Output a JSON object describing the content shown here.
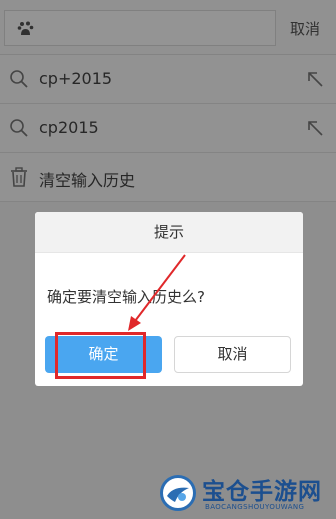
{
  "topbar": {
    "cancel_label": "取消"
  },
  "history": [
    {
      "label": "cp+2015"
    },
    {
      "label": "cp2015"
    }
  ],
  "clear_history": {
    "label": "清空输入历史"
  },
  "dialog": {
    "title": "提示",
    "message": "确定要清空输入历史么?",
    "confirm_label": "确定",
    "cancel_label": "取消"
  },
  "watermark": {
    "title": "宝仓手游网",
    "subtitle": "BAOCANGSHOUYOUWANG"
  },
  "colors": {
    "accent": "#4aa6f0",
    "annotation": "#e0282a",
    "watermark": "#1c4f8f"
  },
  "icons": [
    "baidu-paw-icon",
    "search-icon",
    "arrow-up-left-icon",
    "trash-icon"
  ]
}
